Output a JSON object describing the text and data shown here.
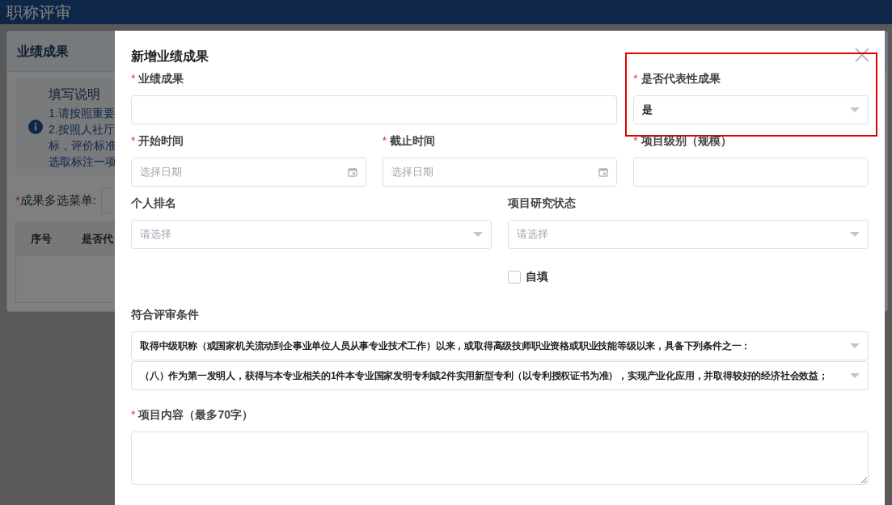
{
  "header": {
    "title": "职称评审"
  },
  "background": {
    "card_title": "业绩成果",
    "notice": {
      "title": "填写说明",
      "lines": [
        "1.请按照重要",
        "2.按照人社厅",
        "标，评价标准",
        "选取标注一项"
      ]
    },
    "filter": {
      "label": "成果多选菜单:",
      "required_mark": "*"
    },
    "table_columns": [
      "序号",
      "是否代"
    ]
  },
  "dialog": {
    "title": "新增业绩成果",
    "fields": [
      {
        "label": "业绩成果",
        "required_mark": "*",
        "kind": "text",
        "highlighted": false
      },
      {
        "label": "是否代表性成果",
        "required_mark": "*",
        "kind": "select",
        "value": "是",
        "highlighted": true
      },
      {
        "label": "开始时间",
        "required_mark": "*",
        "kind": "date",
        "placeholder": "选择日期",
        "highlighted": false
      },
      {
        "label": "截止时间",
        "required_mark": "*",
        "kind": "date",
        "placeholder": "选择日期",
        "highlighted": false
      },
      {
        "label": "项目级别（规模）",
        "required_mark": "*",
        "kind": "text",
        "highlighted": false
      },
      {
        "label": "个人排名",
        "kind": "select",
        "placeholder": "请选择",
        "highlighted": false
      },
      {
        "label": "项目研究状态",
        "kind": "select",
        "placeholder": "请选择",
        "highlighted": false
      }
    ],
    "self_fill": {
      "label": "自填",
      "checked": false
    },
    "criteria": {
      "label": "符合评审条件",
      "selects": [
        "取得中级职称（或国家机关流动到企事业单位人员从事专业技术工作）以来，或取得高级技师职业资格或职业技能等级以来，具备下列条件之一：",
        "（八）作为第一发明人，获得与本专业相关的1件本专业国家发明专利或2件实用新型专利（以专利授权证书为准），实现产业化应用，并取得较好的经济社会效益；"
      ]
    },
    "content": {
      "label": "项目内容（最多70字）",
      "required_mark": "*"
    }
  }
}
